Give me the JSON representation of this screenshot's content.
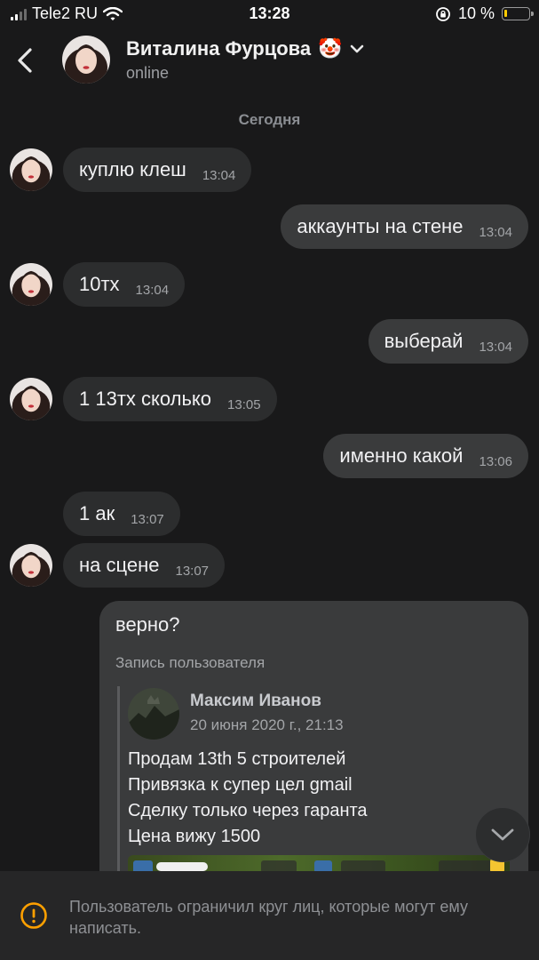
{
  "status_bar": {
    "carrier": "Tele2 RU",
    "time": "13:28",
    "battery": "10 %",
    "battery_level": 0.1
  },
  "header": {
    "name": "Виталина Фурцова",
    "emoji": "🤡",
    "status": "online"
  },
  "date_separator": "Сегодня",
  "messages": [
    {
      "text": "куплю клеш",
      "time": "13:04"
    },
    {
      "text": "аккаунты на стене",
      "time": "13:04"
    },
    {
      "text": "10тх",
      "time": "13:04"
    },
    {
      "text": "выберай",
      "time": "13:04"
    },
    {
      "text": "1 13тх сколько",
      "time": "13:05"
    },
    {
      "text": "именно какой",
      "time": "13:06"
    },
    {
      "text": "1 ак",
      "time": "13:07"
    },
    {
      "text": "на сцене",
      "time": "13:07"
    }
  ],
  "repost": {
    "message": "верно?",
    "label": "Запись пользователя",
    "author": "Максим Иванов",
    "date": "20 июня 2020 г., 21:13",
    "lines": [
      "Продам 13th 5 строителей",
      "Привязка к  супер цел gmail",
      "Сделку только через гаранта",
      "Цена вижу 1500"
    ]
  },
  "restriction_notice": "Пользователь ограничил круг лиц, которые могут ему написать.",
  "icons": {
    "back": "chevron-left-icon",
    "dropdown": "chevron-down-icon",
    "scroll_down": "chevron-down-icon",
    "warning": "exclamation-circle-icon",
    "wifi": "wifi-icon",
    "lock": "rotation-lock-icon"
  },
  "colors": {
    "background": "#19191a",
    "bubble_in": "#2c2d2e",
    "bubble_out": "#3a3b3c",
    "warning": "#ffa000"
  }
}
